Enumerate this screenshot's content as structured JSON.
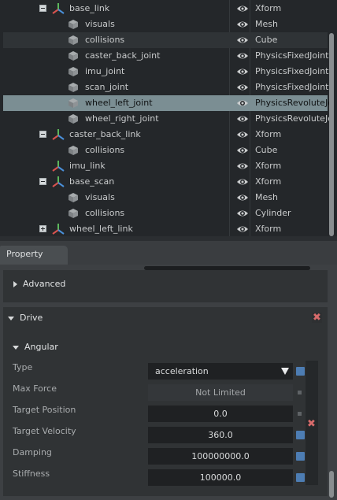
{
  "stage": {
    "rows": [
      {
        "name": "base_link",
        "type": "Xform",
        "icon": "xform-icon",
        "expander": "minus",
        "depth": 0
      },
      {
        "name": "visuals",
        "type": "Mesh",
        "icon": "mesh-icon",
        "expander": "",
        "depth": 1
      },
      {
        "name": "collisions",
        "type": "Cube",
        "icon": "mesh-icon",
        "expander": "",
        "depth": 1
      },
      {
        "name": "caster_back_joint",
        "type": "PhysicsFixedJoint",
        "icon": "mesh-icon",
        "expander": "",
        "depth": 1
      },
      {
        "name": "imu_joint",
        "type": "PhysicsFixedJoint",
        "icon": "mesh-icon",
        "expander": "",
        "depth": 1
      },
      {
        "name": "scan_joint",
        "type": "PhysicsFixedJoint",
        "icon": "mesh-icon",
        "expander": "",
        "depth": 1
      },
      {
        "name": "wheel_left_joint",
        "type": "PhysicsRevoluteJoint",
        "icon": "mesh-icon",
        "expander": "",
        "depth": 1,
        "selected": true
      },
      {
        "name": "wheel_right_joint",
        "type": "PhysicsRevoluteJoint",
        "icon": "mesh-icon",
        "expander": "",
        "depth": 1
      },
      {
        "name": "caster_back_link",
        "type": "Xform",
        "icon": "xform-icon",
        "expander": "minus",
        "depth": 0
      },
      {
        "name": "collisions",
        "type": "Cube",
        "icon": "mesh-icon",
        "expander": "",
        "depth": 1
      },
      {
        "name": "imu_link",
        "type": "Xform",
        "icon": "xform-icon",
        "expander": "",
        "depth": 0
      },
      {
        "name": "base_scan",
        "type": "Xform",
        "icon": "xform-icon",
        "expander": "minus",
        "depth": 0
      },
      {
        "name": "visuals",
        "type": "Mesh",
        "icon": "mesh-icon",
        "expander": "",
        "depth": 1
      },
      {
        "name": "collisions",
        "type": "Cylinder",
        "icon": "mesh-icon",
        "expander": "",
        "depth": 1
      },
      {
        "name": "wheel_left_link",
        "type": "Xform",
        "icon": "xform-icon",
        "expander": "plus",
        "depth": 0
      }
    ]
  },
  "property": {
    "tab_label": "Property",
    "advanced_label": "Advanced",
    "drive_label": "Drive",
    "angular_label": "Angular",
    "fields": [
      {
        "label": "Type",
        "value": "acceleration",
        "kind": "dropdown",
        "mark": "blue"
      },
      {
        "label": "Max Force",
        "value": "Not Limited",
        "kind": "disabled",
        "mark": "dot"
      },
      {
        "label": "Target Position",
        "value": "0.0",
        "kind": "input",
        "mark": "dot"
      },
      {
        "label": "Target Velocity",
        "value": "360.0",
        "kind": "input",
        "mark": "blue"
      },
      {
        "label": "Damping",
        "value": "100000000.0",
        "kind": "input",
        "mark": "blue"
      },
      {
        "label": "Stiffness",
        "value": "100000.0",
        "kind": "input",
        "mark": "blue"
      }
    ]
  },
  "colors": {
    "selection": "#7b8e93",
    "accent_blue": "#4d7db3",
    "close_red": "#d86b6b",
    "xform_red": "#d9534f",
    "xform_green": "#5cb85c",
    "xform_blue": "#4a90d9"
  }
}
